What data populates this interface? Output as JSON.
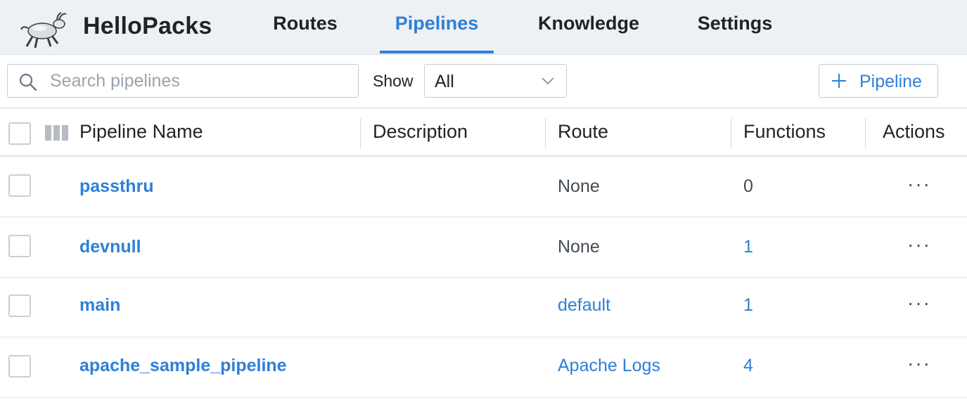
{
  "app": {
    "name": "HelloPacks"
  },
  "nav": {
    "tabs": [
      {
        "label": "Routes",
        "active": false
      },
      {
        "label": "Pipelines",
        "active": true
      },
      {
        "label": "Knowledge",
        "active": false
      },
      {
        "label": "Settings",
        "active": false
      }
    ]
  },
  "toolbar": {
    "search_placeholder": "Search pipelines",
    "search_value": "",
    "show_label": "Show",
    "show_selected": "All",
    "add_button_label": "Pipeline"
  },
  "table": {
    "columns": [
      "Pipeline Name",
      "Description",
      "Route",
      "Functions",
      "Actions"
    ],
    "rows": [
      {
        "name": "passthru",
        "description": "",
        "route": "None",
        "route_is_link": false,
        "functions": "0",
        "functions_is_link": false,
        "actions": "···"
      },
      {
        "name": "devnull",
        "description": "",
        "route": "None",
        "route_is_link": false,
        "functions": "1",
        "functions_is_link": true,
        "actions": "···"
      },
      {
        "name": "main",
        "description": "",
        "route": "default",
        "route_is_link": true,
        "functions": "1",
        "functions_is_link": true,
        "actions": "···"
      },
      {
        "name": "apache_sample_pipeline",
        "description": "",
        "route": "Apache Logs",
        "route_is_link": true,
        "functions": "4",
        "functions_is_link": true,
        "actions": "···"
      }
    ]
  },
  "colors": {
    "accent": "#2f7fd6",
    "topbar_bg": "#eef1f4",
    "text": "#1f2328",
    "muted": "#444b53"
  },
  "icons": [
    "goat-logo-icon",
    "search-icon",
    "chevron-down-icon",
    "plus-icon",
    "columns-icon",
    "more-options-icon"
  ]
}
